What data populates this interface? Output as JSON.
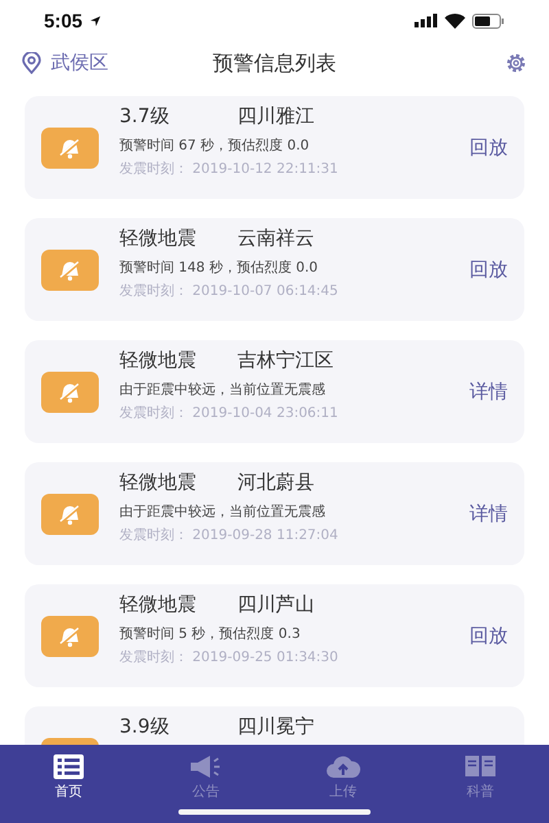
{
  "status_bar": {
    "time": "5:05"
  },
  "header": {
    "location": "武侯区",
    "title": "预警信息列表"
  },
  "alerts": [
    {
      "magnitude": "3.7级",
      "place": "四川雅江",
      "detail": "预警时间 67 秒，预估烈度 0.0",
      "time": "发震时刻：  2019-10-12 22:11:31",
      "action": "回放"
    },
    {
      "magnitude": "轻微地震",
      "place": "云南祥云",
      "detail": "预警时间 148 秒，预估烈度 0.0",
      "time": "发震时刻：  2019-10-07 06:14:45",
      "action": "回放"
    },
    {
      "magnitude": "轻微地震",
      "place": "吉林宁江区",
      "detail": "由于距震中较远，当前位置无震感",
      "time": "发震时刻：  2019-10-04 23:06:11",
      "action": "详情"
    },
    {
      "magnitude": "轻微地震",
      "place": "河北蔚县",
      "detail": "由于距震中较远，当前位置无震感",
      "time": "发震时刻：  2019-09-28 11:27:04",
      "action": "详情"
    },
    {
      "magnitude": "轻微地震",
      "place": "四川芦山",
      "detail": "预警时间 5 秒，预估烈度 0.3",
      "time": "发震时刻：  2019-09-25 01:34:30",
      "action": "回放"
    },
    {
      "magnitude": "3.9级",
      "place": "四川冕宁"
    }
  ],
  "tab_bar": [
    {
      "kind": "list",
      "label": "首页",
      "selected": true
    },
    {
      "kind": "megaphone",
      "label": "公告",
      "selected": false
    },
    {
      "kind": "cloud",
      "label": "上传",
      "selected": false
    },
    {
      "kind": "book",
      "label": "科普",
      "selected": false
    }
  ]
}
